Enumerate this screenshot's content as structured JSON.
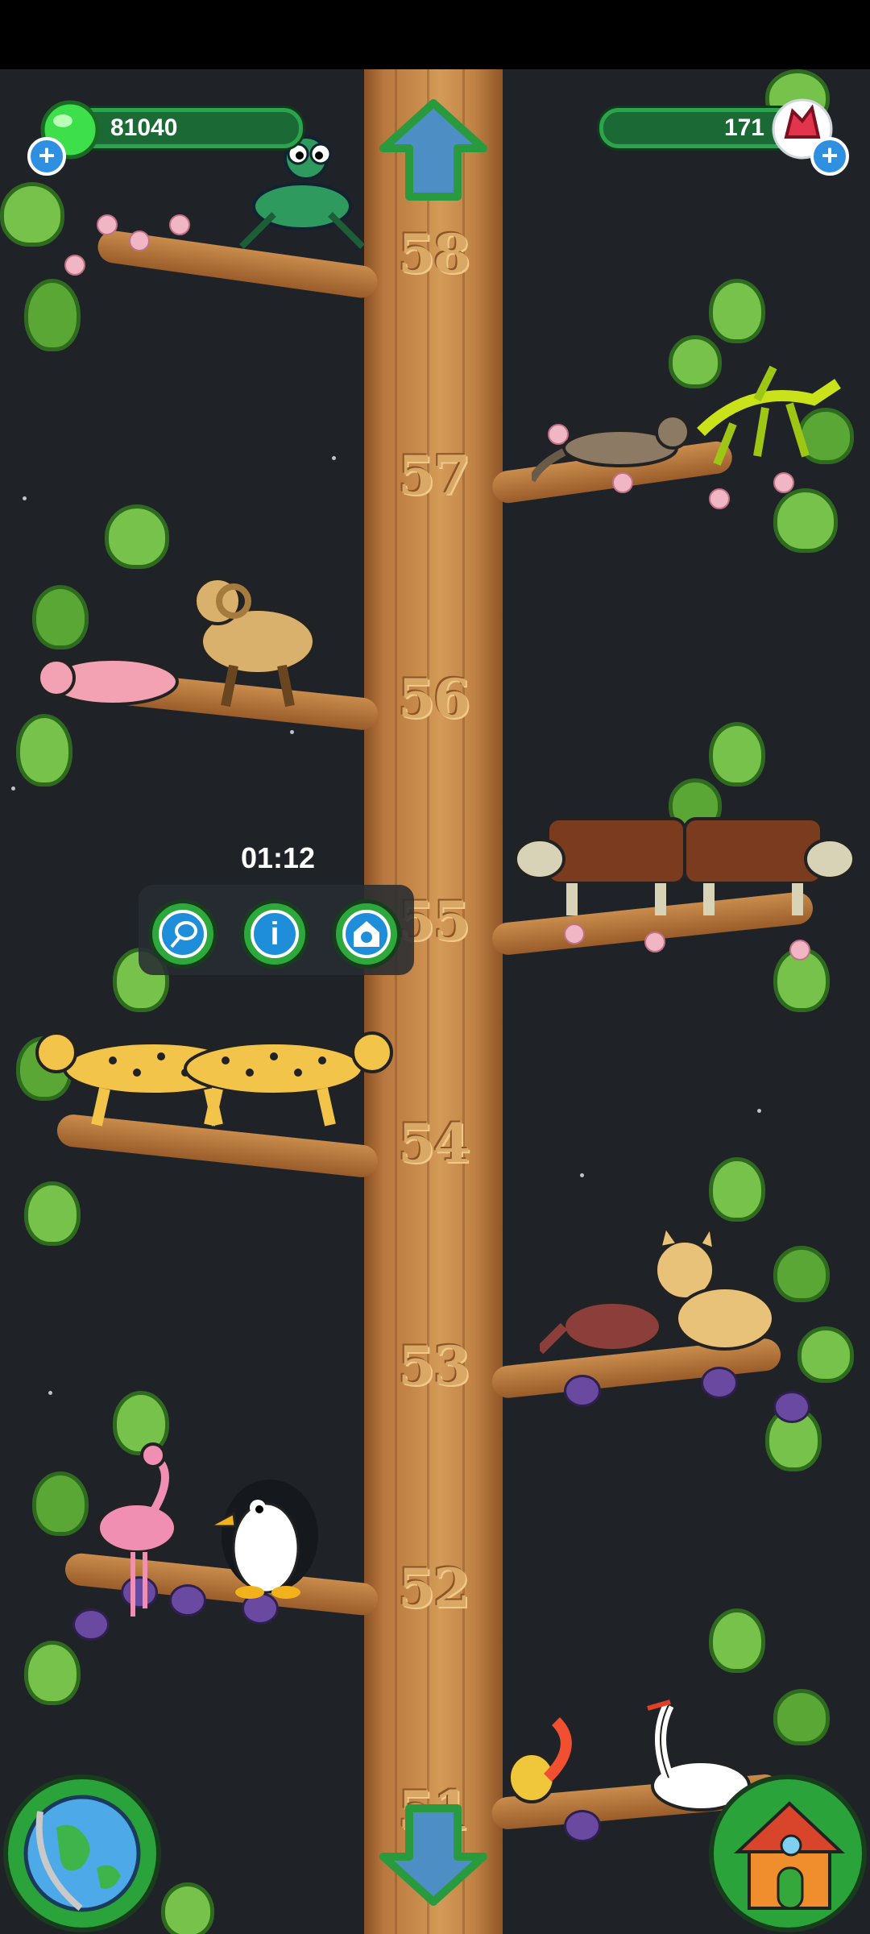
{
  "hud": {
    "coins_value": "81040",
    "gems_value": "171",
    "colors": {
      "bar": "#1b6a35",
      "bar_border": "#2ea34d",
      "plus": "#2f8fe0"
    }
  },
  "levels": [
    "58",
    "57",
    "56",
    "55",
    "54",
    "53",
    "52",
    "51"
  ],
  "popup": {
    "timer": "01:12",
    "buttons": [
      {
        "icon": "net-icon"
      },
      {
        "icon": "info-icon"
      },
      {
        "icon": "shelter-icon"
      }
    ]
  },
  "animals": [
    "mantis",
    "weasel",
    "leafy-sea-dragon",
    "mole-rat",
    "bighorn-sheep",
    "cow",
    "cow",
    "cheetah",
    "cheetah",
    "aardvark",
    "lynx",
    "flamingo",
    "penguin",
    "squirrel",
    "swan"
  ],
  "nav": {
    "up": "up-arrow-icon",
    "down": "down-arrow-icon",
    "world": "globe-icon",
    "home": "house-icon"
  }
}
